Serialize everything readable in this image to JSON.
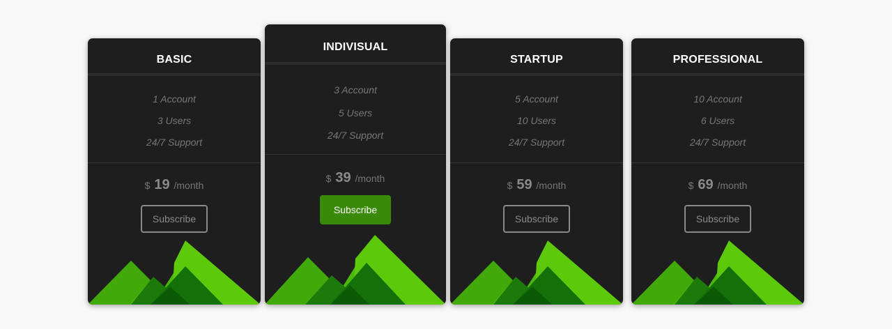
{
  "plans": [
    {
      "key": "basic",
      "title": "BASIC",
      "features": [
        "1 Account",
        "3 Users",
        "24/7 Support"
      ],
      "currency": "$",
      "price": "19",
      "period": "/month",
      "button": "Subscribe"
    },
    {
      "key": "indiv",
      "title": "INDIVISUAL",
      "features": [
        "3 Account",
        "5 Users",
        "24/7 Support"
      ],
      "currency": "$",
      "price": "39",
      "period": "/month",
      "button": "Subscribe",
      "featured": true
    },
    {
      "key": "startup",
      "title": "STARTUP",
      "features": [
        "5 Account",
        "10 Users",
        "24/7 Support"
      ],
      "currency": "$",
      "price": "59",
      "period": "/month",
      "button": "Subscribe"
    },
    {
      "key": "pro",
      "title": "PROFESSIONAL",
      "features": [
        "10 Account",
        "6 Users",
        "24/7 Support"
      ],
      "currency": "$",
      "price": "69",
      "period": "/month",
      "button": "Subscribe"
    }
  ],
  "colors": {
    "card": "#1e1e1e",
    "accent": "#3a8a0a",
    "mountain_light": "#5cc90a",
    "mountain_mid": "#2f8f0a",
    "mountain_dark": "#136b0a"
  }
}
